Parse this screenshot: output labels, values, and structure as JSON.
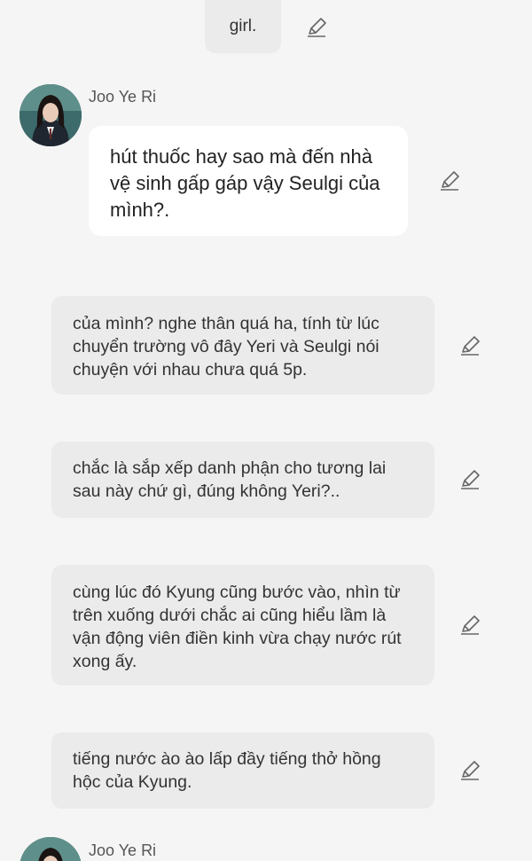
{
  "top_message": {
    "text": "girl."
  },
  "speaker_1": {
    "name": "Joo Ye Ri"
  },
  "dialog": {
    "text": "hút thuốc hay sao mà đến nhà vệ sinh gấp gáp vậy Seulgi của mình?."
  },
  "narrations": [
    {
      "text": "của mình? nghe thân quá ha, tính từ lúc chuyển trường vô đây Yeri và Seulgi nói chuyện với nhau chưa quá 5p."
    },
    {
      "text": "chắc là sắp xếp danh phận cho tương lai sau này chứ gì, đúng không Yeri?.."
    },
    {
      "text": "cùng lúc đó Kyung cũng bước vào, nhìn từ trên xuống dưới chắc ai cũng hiểu lầm là vận động viên điền kinh vừa chạy nước rút xong ấy."
    },
    {
      "text": "tiếng nước ào ào lấp đầy tiếng thở hồng hộc của Kyung."
    }
  ],
  "speaker_2": {
    "name": "Joo Ye Ri"
  },
  "icons": {
    "edit": "pencil-icon"
  },
  "colors": {
    "background": "#f5f5f5",
    "narration_bubble": "#ebebeb",
    "dialog_bubble": "#ffffff"
  }
}
